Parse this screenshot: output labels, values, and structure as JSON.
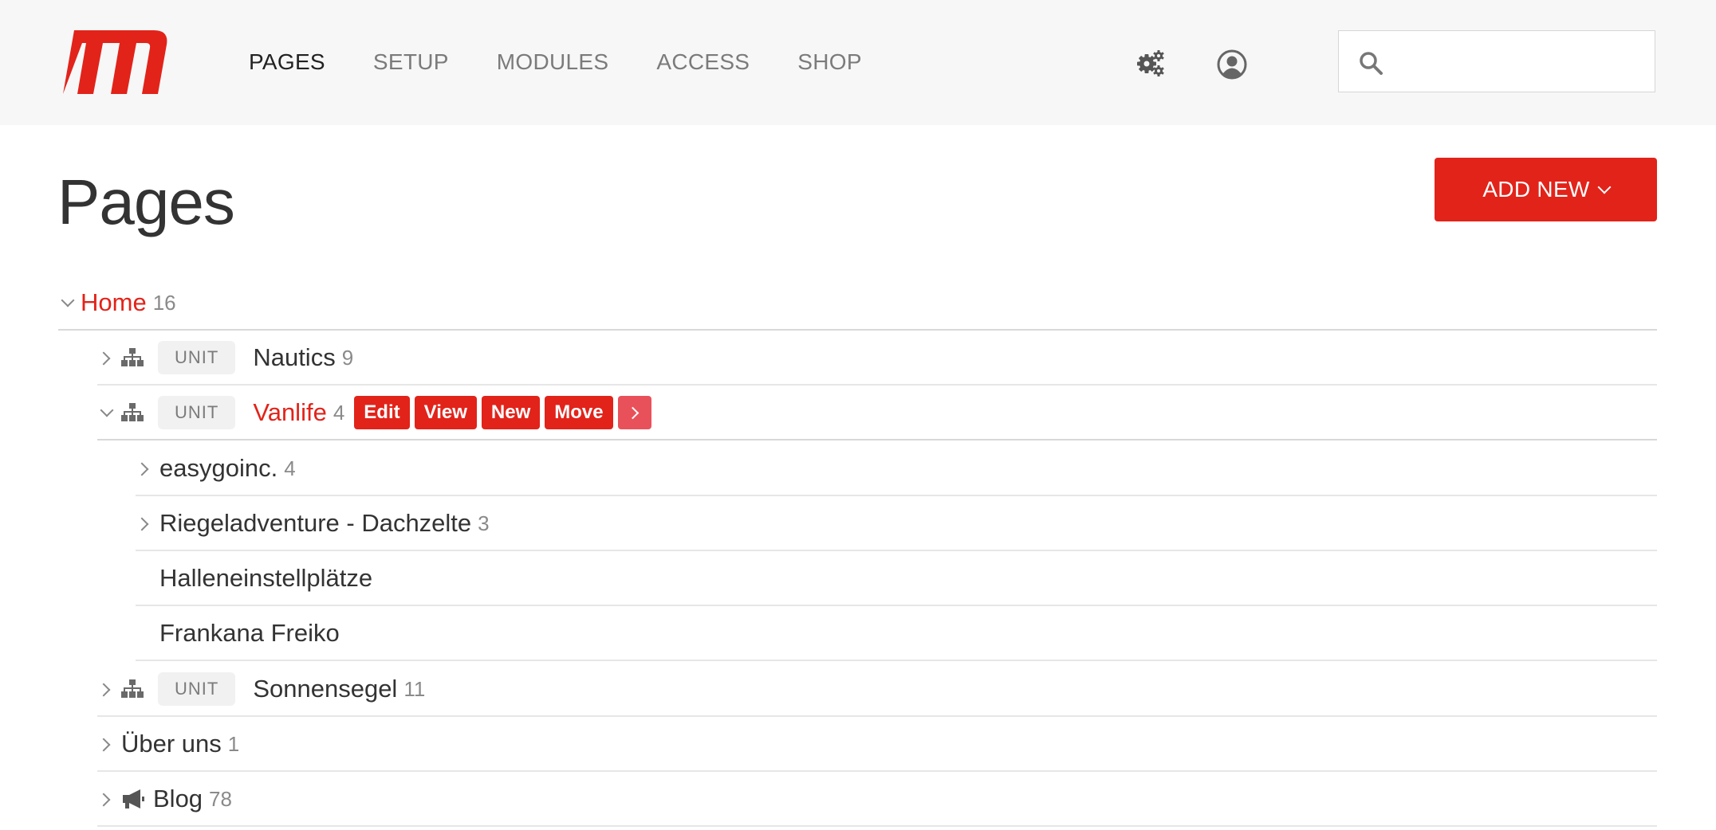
{
  "header": {
    "nav": [
      {
        "label": "PAGES",
        "active": true
      },
      {
        "label": "SETUP",
        "active": false
      },
      {
        "label": "MODULES",
        "active": false
      },
      {
        "label": "ACCESS",
        "active": false
      },
      {
        "label": "SHOP",
        "active": false
      }
    ],
    "search": {
      "placeholder": "",
      "value": ""
    },
    "icons": [
      "gear-icon",
      "user-icon",
      "search-icon"
    ]
  },
  "main": {
    "title": "Pages",
    "add_new_label": "ADD NEW"
  },
  "tree": {
    "home": {
      "title": "Home",
      "count": "16"
    },
    "nautics": {
      "badge": "UNIT",
      "title": "Nautics",
      "count": "9"
    },
    "vanlife": {
      "badge": "UNIT",
      "title": "Vanlife",
      "count": "4",
      "actions": {
        "edit": "Edit",
        "view": "View",
        "new": "New",
        "move": "Move"
      }
    },
    "easygoinc": {
      "title": "easygoinc.",
      "count": "4"
    },
    "riegel": {
      "title": "Riegeladventure - Dachzelte",
      "count": "3"
    },
    "hallen": {
      "title": "Halleneinstellplätze"
    },
    "frankana": {
      "title": "Frankana Freiko"
    },
    "sonnensegel": {
      "badge": "UNIT",
      "title": "Sonnensegel",
      "count": "11"
    },
    "ueber": {
      "title": "Über uns",
      "count": "1"
    },
    "blog": {
      "title": "Blog",
      "count": "78"
    }
  },
  "colors": {
    "accent": "#e2231a",
    "accent_pale": "#e9515a",
    "topbar_bg": "#f7f7f7"
  }
}
